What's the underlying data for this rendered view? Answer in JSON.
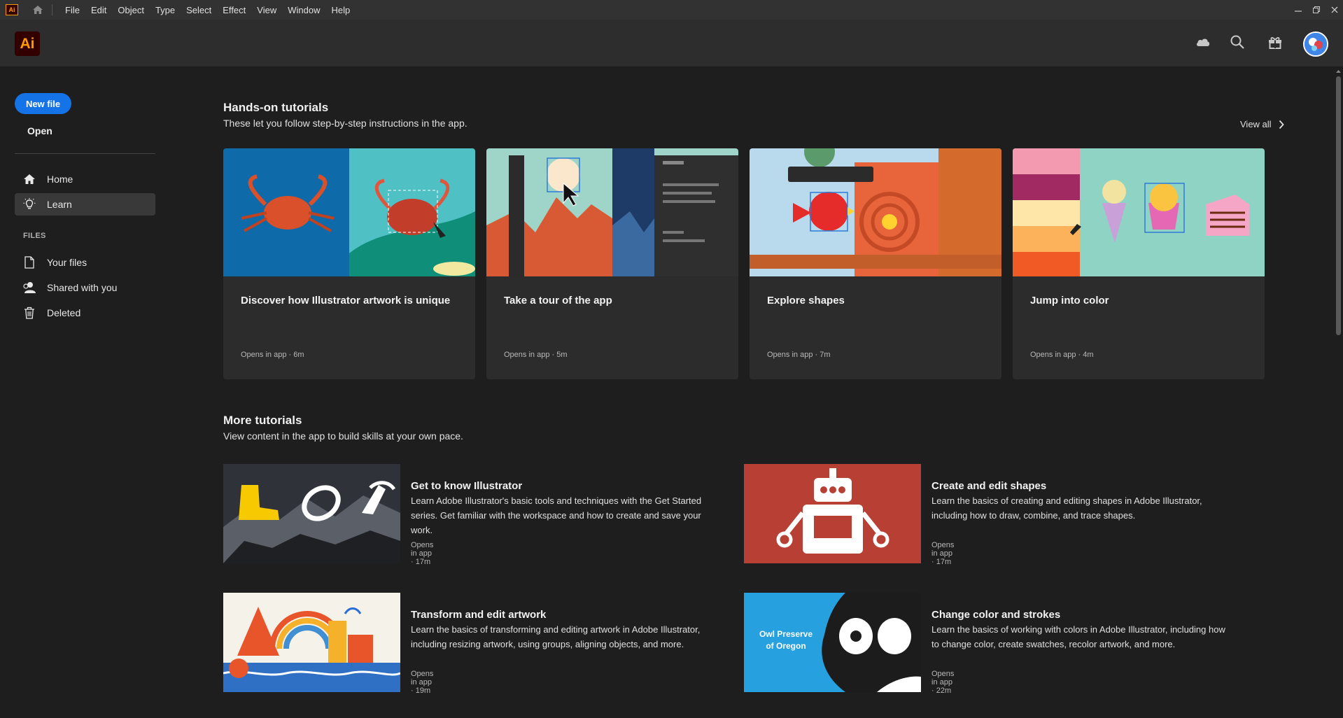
{
  "menubar": {
    "app_icon_text": "Ai",
    "items": [
      "File",
      "Edit",
      "Object",
      "Type",
      "Select",
      "Effect",
      "View",
      "Window",
      "Help"
    ]
  },
  "header": {
    "logo_text": "Ai",
    "icons": [
      "cloud-icon",
      "search-icon",
      "gift-icon",
      "avatar"
    ]
  },
  "sidebar": {
    "new_file_label": "New file",
    "open_label": "Open",
    "nav": [
      {
        "label": "Home",
        "icon": "home-icon"
      },
      {
        "label": "Learn",
        "icon": "lightbulb-icon",
        "active": true
      }
    ],
    "files_section_label": "FILES",
    "files": [
      {
        "label": "Your files",
        "icon": "file-icon"
      },
      {
        "label": "Shared with you",
        "icon": "shared-user-icon"
      },
      {
        "label": "Deleted",
        "icon": "trash-icon"
      }
    ]
  },
  "hands_on": {
    "title": "Hands-on tutorials",
    "subtitle": "These let you follow step-by-step instructions in the app.",
    "view_all_label": "View all",
    "cards": [
      {
        "title": "Discover how Illustrator artwork is unique",
        "meta": "Opens in app  ·  6m"
      },
      {
        "title": "Take a tour of the app",
        "meta": "Opens in app  ·  5m"
      },
      {
        "title": "Explore shapes",
        "meta": "Opens in app  ·  7m"
      },
      {
        "title": "Jump into color",
        "meta": "Opens in app  ·  4m"
      }
    ]
  },
  "more": {
    "title": "More tutorials",
    "subtitle": "View content in the app to build skills at your own pace.",
    "items": [
      {
        "title": "Get to know Illustrator",
        "desc": "Learn Adobe Illustrator's basic tools and techniques with the Get Started series. Get familiar with the workspace and how to create and save your work.",
        "meta": "Opens in app  ·  17m"
      },
      {
        "title": "Create and edit shapes",
        "desc": "Learn the basics of creating and editing shapes in Adobe Illustrator, including how to draw, combine, and trace shapes.",
        "meta": "Opens in app  ·  17m"
      },
      {
        "title": "Transform and edit artwork",
        "desc": "Learn the basics of transforming and editing artwork in Adobe Illustrator, including resizing artwork, using groups, aligning objects, and more.",
        "meta": "Opens in app  ·  19m"
      },
      {
        "title": "Change color and strokes",
        "desc": "Learn the basics of working with colors in Adobe Illustrator, including how to change color, create swatches, recolor artwork, and more.",
        "meta": "Opens in app  ·  22m"
      }
    ],
    "owl_text": [
      "Owl Preserve",
      "of Oregon"
    ]
  },
  "colors": {
    "accent": "#1473e6",
    "brand_bg": "#330000",
    "brand_fg": "#ff9a00"
  }
}
